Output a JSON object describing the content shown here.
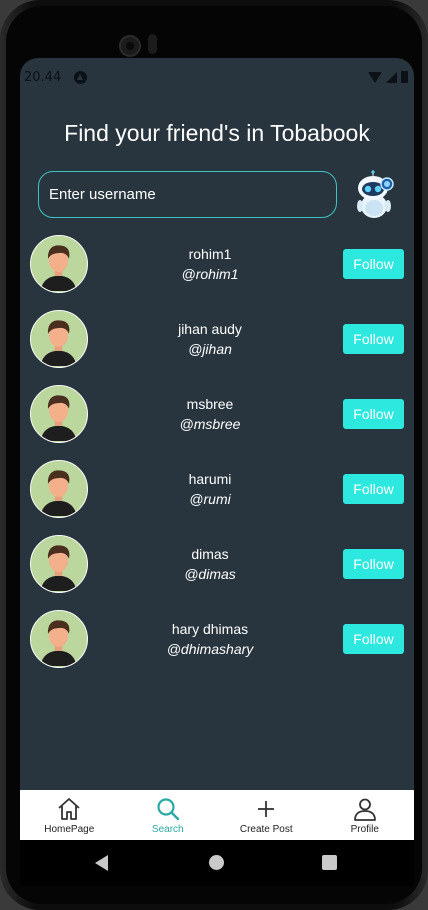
{
  "status_bar": {
    "time": "20.44"
  },
  "header": {
    "title": "Find your friend's in Tobabook"
  },
  "search": {
    "placeholder": "Enter username"
  },
  "users": [
    {
      "name": "rohim1",
      "handle": "@rohim1",
      "follow_label": "Follow"
    },
    {
      "name": "jihan audy",
      "handle": "@jihan",
      "follow_label": "Follow"
    },
    {
      "name": "msbree",
      "handle": "@msbree",
      "follow_label": "Follow"
    },
    {
      "name": "harumi",
      "handle": "@rumi",
      "follow_label": "Follow"
    },
    {
      "name": "dimas",
      "handle": "@dimas",
      "follow_label": "Follow"
    },
    {
      "name": "hary dhimas",
      "handle": "@dhimashary",
      "follow_label": "Follow"
    }
  ],
  "bottom_nav": {
    "items": [
      {
        "label": "HomePage",
        "icon": "home-icon"
      },
      {
        "label": "Search",
        "icon": "search-icon",
        "active": true
      },
      {
        "label": "Create Post",
        "icon": "plus-icon"
      },
      {
        "label": "Profile",
        "icon": "person-icon"
      }
    ]
  },
  "colors": {
    "background": "#28353e",
    "accent": "#2de8df",
    "input_border": "#3fc5c0",
    "nav_active": "#2aa9a3"
  }
}
